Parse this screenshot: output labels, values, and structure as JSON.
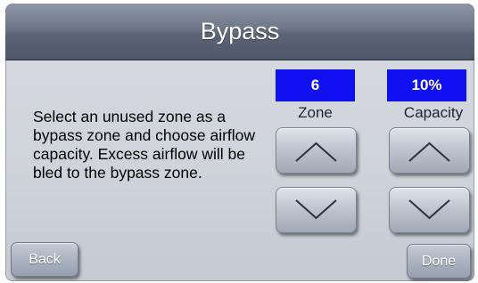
{
  "header": {
    "title": "Bypass"
  },
  "instructions": "Select an unused zone as a bypass zone and choose airflow capacity.  Excess airflow will be bled to the bypass zone.",
  "zone": {
    "value": "6",
    "label": "Zone"
  },
  "capacity": {
    "value": "10%",
    "label": "Capacity"
  },
  "icons": {
    "up": "chevron-up-icon",
    "down": "chevron-down-icon"
  },
  "colors": {
    "value_box": "#1010f0",
    "title_bar": "#5c6577"
  },
  "nav": {
    "back_label": "Back",
    "done_label": "Done"
  }
}
